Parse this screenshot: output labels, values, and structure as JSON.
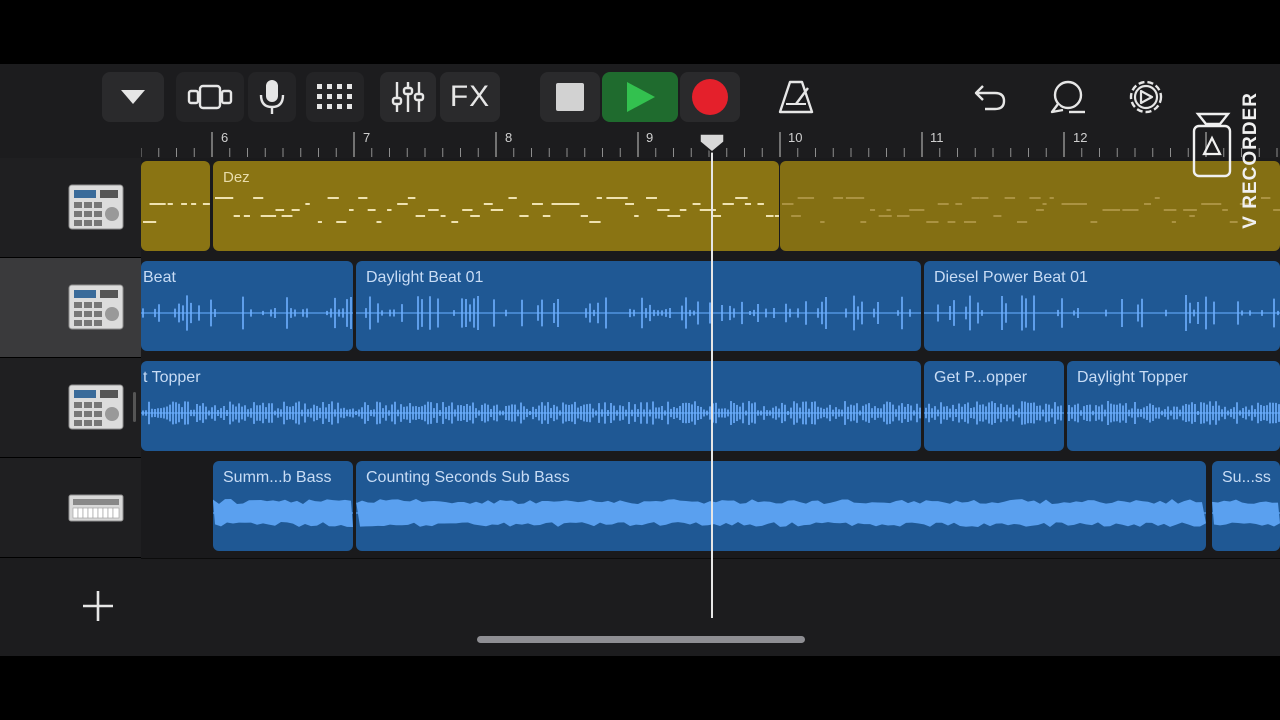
{
  "toolbar": {
    "icons": [
      "track-view-dropdown-icon",
      "browser-icon",
      "microphone-icon",
      "grid-icon",
      "mixer-icon",
      "fx-button",
      "stop-icon",
      "play-icon",
      "record-icon",
      "metronome-icon",
      "undo-icon",
      "loop-icon",
      "settings-icon"
    ],
    "fx_label": "FX"
  },
  "ruler": {
    "bars": [
      "6",
      "7",
      "8",
      "9",
      "10",
      "11",
      "12"
    ]
  },
  "tracks": [
    {
      "instrument": "drum-machine-icon",
      "selected": false,
      "regions": [
        {
          "name": "",
          "color": "#8a7413"
        },
        {
          "name": "Dez",
          "color": "#8a7413"
        }
      ]
    },
    {
      "instrument": "drum-machine-icon",
      "selected": true,
      "regions": [
        {
          "name": "Beat",
          "color": "#1f5894"
        },
        {
          "name": "Daylight Beat 01",
          "color": "#1f5894"
        },
        {
          "name": "Diesel Power Beat 01",
          "color": "#1f5894"
        }
      ]
    },
    {
      "instrument": "drum-machine-icon",
      "selected": false,
      "regions": [
        {
          "name": "t Topper",
          "color": "#1f5894"
        },
        {
          "name": "Get P...opper",
          "color": "#1f5894"
        },
        {
          "name": "Daylight Topper",
          "color": "#1f5894"
        }
      ]
    },
    {
      "instrument": "bass-synth-icon",
      "selected": false,
      "regions": [
        {
          "name": "Summ...b Bass",
          "color": "#1f5894"
        },
        {
          "name": "Counting Seconds Sub Bass",
          "color": "#1f5894"
        },
        {
          "name": "Su...ss",
          "color": "#1f5894"
        }
      ]
    }
  ],
  "add_track_label": "+",
  "watermark": "V RECORDER",
  "colors": {
    "play": "#2ea043",
    "record": "#e4202b",
    "midi_region": "#8a7413",
    "audio_region": "#1f5894"
  }
}
